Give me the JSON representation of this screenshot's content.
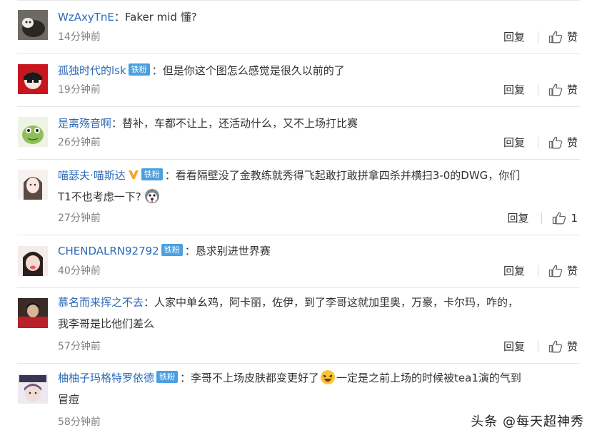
{
  "comments": [
    {
      "username": "WzAxyTnE",
      "badge": "",
      "colon": "：",
      "text": "Faker mid 懂?",
      "text2": "",
      "time": "14分钟前",
      "reply": "回复",
      "like": "赞"
    },
    {
      "username": "孤独时代的lsk",
      "badge": "铁粉",
      "colon": "：",
      "text": "但是你这个图怎么感觉是很久以前的了",
      "text2": "",
      "time": "19分钟前",
      "reply": "回复",
      "like": "赞"
    },
    {
      "username": "是离殇音啊",
      "badge": "",
      "colon": "：",
      "text": "替补，车都不让上，还活动什么，又不上场打比赛",
      "text2": "",
      "time": "26分钟前",
      "reply": "回复",
      "like": "赞"
    },
    {
      "username": "喵瑟夫·喵斯达",
      "badge": "铁粉",
      "colon": "：",
      "text": "看看隔壁没了金教练就秀得飞起敢打敢拼拿四杀并横扫3-0的DWG，你们",
      "text2": "T1不也考虑一下?",
      "time": "27分钟前",
      "reply": "回复",
      "like": "1"
    },
    {
      "username": "CHENDALRN92792",
      "badge": "铁粉",
      "colon": "：",
      "text": "恳求别进世界赛",
      "text2": "",
      "time": "40分钟前",
      "reply": "回复",
      "like": "赞"
    },
    {
      "username": "慕名而来挥之不去",
      "badge": "",
      "colon": "：",
      "text": "人家中单幺鸡，阿卡丽，佐伊，到了李哥这就加里奥，万豪，卡尔玛，咋的，",
      "text2": "我李哥是比他们差么",
      "time": "57分钟前",
      "reply": "回复",
      "like": "赞"
    },
    {
      "username": "柚柚子玛格特罗依德",
      "badge": "铁粉",
      "colon": "：",
      "text": "李哥不上场皮肤都变更好了",
      "text_after_emoji": "一定是之前上场的时候被tea1演的气到",
      "text2": "冒痘",
      "time": "58分钟前",
      "reply": "回复",
      "like": "赞"
    }
  ],
  "watermark": "头条 @每天超神秀"
}
